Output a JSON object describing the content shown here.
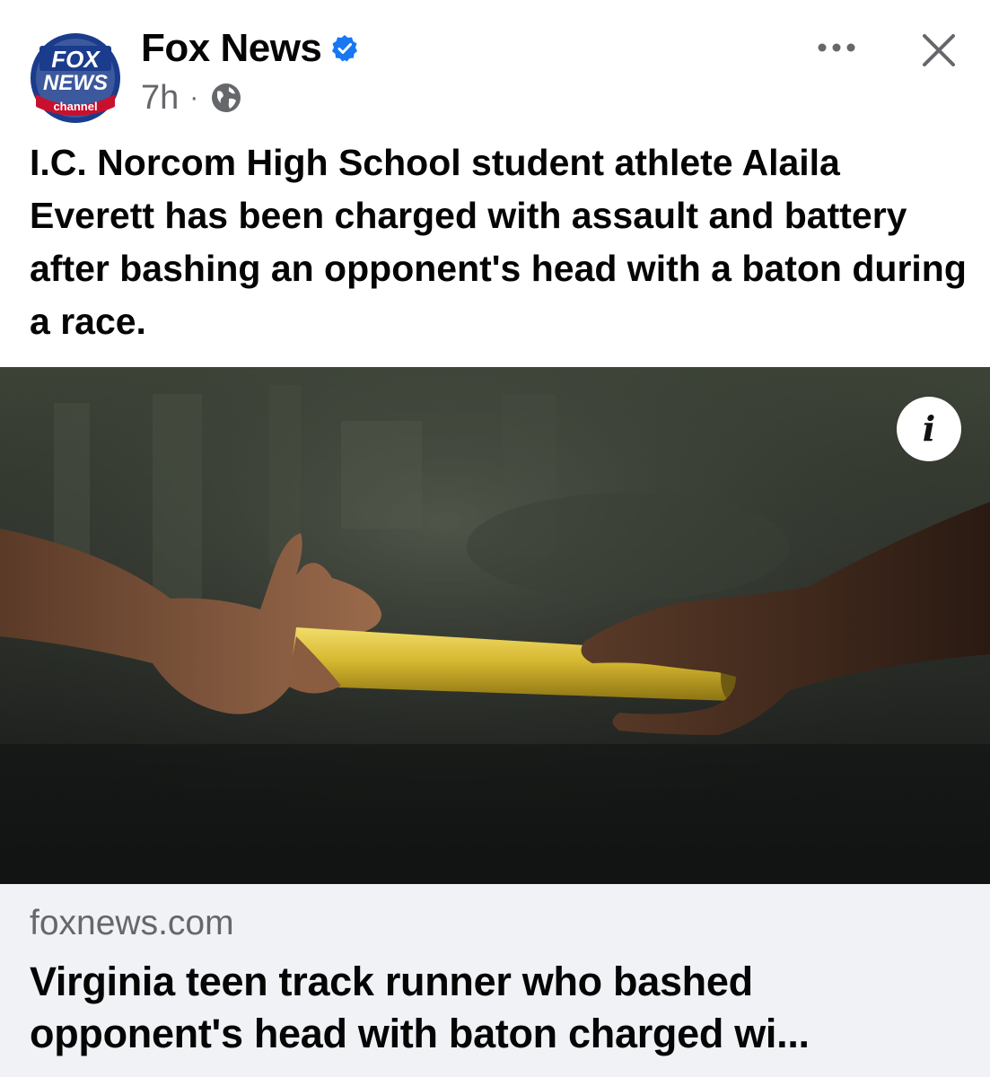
{
  "post": {
    "page_name": "Fox News",
    "verified_icon": "verified-badge-icon",
    "timestamp": "7h",
    "separator": "·",
    "audience_icon": "globe-icon",
    "more_icon": "more-options-icon",
    "close_icon": "close-icon",
    "caption": "I.C. Norcom High School student athlete Alaila Everett has been charged with assault and battery after bashing an opponent's head with a baton during a race."
  },
  "avatar": {
    "logo_text_top": "FOX",
    "logo_text_middle": "NEWS",
    "logo_text_bottom": "channel"
  },
  "media": {
    "info_icon": "info-icon",
    "info_glyph": "i"
  },
  "link_preview": {
    "domain": "foxnews.com",
    "title": "Virginia teen track runner who bashed opponent's head with baton charged wi..."
  },
  "colors": {
    "verified_blue": "#1877f2",
    "secondary_text": "#65676b",
    "link_card_bg": "#f0f2f5",
    "fox_blue": "#1b3c8c",
    "fox_red": "#c8102e"
  }
}
